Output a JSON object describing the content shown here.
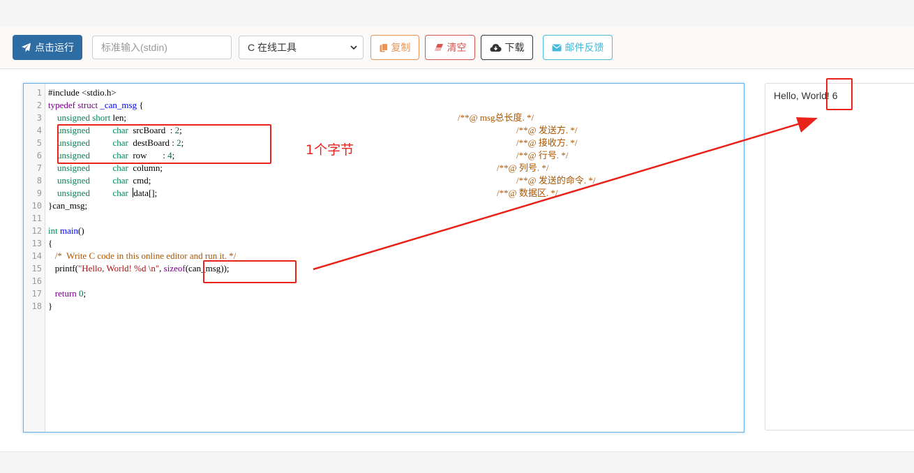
{
  "toolbar": {
    "run_label": "点击运行",
    "stdin_placeholder": "标准输入(stdin)",
    "language_selected": "C 在线工具",
    "copy_label": "复制",
    "clear_label": "清空",
    "download_label": "下载",
    "feedback_label": "邮件反馈"
  },
  "editor": {
    "line_numbers": [
      "1",
      "2",
      "3",
      "4",
      "5",
      "6",
      "7",
      "8",
      "9",
      "10",
      "11",
      "12",
      "13",
      "14",
      "15",
      "16",
      "17",
      "18"
    ],
    "lines": [
      [
        {
          "t": "#include <stdio.h>",
          "c": ""
        }
      ],
      [
        {
          "t": "typedef",
          "c": "kw"
        },
        {
          "t": " ",
          "c": ""
        },
        {
          "t": "struct",
          "c": "kw"
        },
        {
          "t": " ",
          "c": ""
        },
        {
          "t": "_can_msg",
          "c": "df"
        },
        {
          "t": " {",
          "c": ""
        }
      ],
      [
        {
          "t": "    ",
          "c": ""
        },
        {
          "t": "unsigned",
          "c": "ty"
        },
        {
          "t": " ",
          "c": ""
        },
        {
          "t": "short",
          "c": "ty"
        },
        {
          "t": " len;",
          "c": ""
        }
      ],
      [
        {
          "t": "    ",
          "c": ""
        },
        {
          "t": "unsigned",
          "c": "ty"
        },
        {
          "t": "          ",
          "c": ""
        },
        {
          "t": "char",
          "c": "ty"
        },
        {
          "t": "  srcBoard  : ",
          "c": ""
        },
        {
          "t": "2",
          "c": "nm"
        },
        {
          "t": ";",
          "c": ""
        }
      ],
      [
        {
          "t": "    ",
          "c": ""
        },
        {
          "t": "unsigned",
          "c": "ty"
        },
        {
          "t": "          ",
          "c": ""
        },
        {
          "t": "char",
          "c": "ty"
        },
        {
          "t": "  destBoard : ",
          "c": ""
        },
        {
          "t": "2",
          "c": "nm"
        },
        {
          "t": ";",
          "c": ""
        }
      ],
      [
        {
          "t": "    ",
          "c": ""
        },
        {
          "t": "unsigned",
          "c": "ty"
        },
        {
          "t": "          ",
          "c": ""
        },
        {
          "t": "char",
          "c": "ty"
        },
        {
          "t": "  row       : ",
          "c": ""
        },
        {
          "t": "4",
          "c": "nm"
        },
        {
          "t": ";",
          "c": ""
        }
      ],
      [
        {
          "t": "    ",
          "c": ""
        },
        {
          "t": "unsigned",
          "c": "ty"
        },
        {
          "t": "          ",
          "c": ""
        },
        {
          "t": "char",
          "c": "ty"
        },
        {
          "t": "  column;",
          "c": ""
        }
      ],
      [
        {
          "t": "    ",
          "c": ""
        },
        {
          "t": "unsigned",
          "c": "ty"
        },
        {
          "t": "          ",
          "c": ""
        },
        {
          "t": "char",
          "c": "ty"
        },
        {
          "t": "  cmd;",
          "c": ""
        }
      ],
      [
        {
          "t": "    ",
          "c": ""
        },
        {
          "t": "unsigned",
          "c": "ty"
        },
        {
          "t": "          ",
          "c": ""
        },
        {
          "t": "char",
          "c": "ty"
        },
        {
          "t": "  ",
          "c": ""
        },
        {
          "t": "|",
          "c": "cursor"
        },
        {
          "t": "data[];",
          "c": ""
        }
      ],
      [
        {
          "t": "}can_msg;",
          "c": ""
        }
      ],
      [],
      [
        {
          "t": "int",
          "c": "ty"
        },
        {
          "t": " ",
          "c": ""
        },
        {
          "t": "main",
          "c": "df"
        },
        {
          "t": "()",
          "c": ""
        }
      ],
      [
        {
          "t": "{",
          "c": ""
        }
      ],
      [
        {
          "t": "   ",
          "c": ""
        },
        {
          "t": "/*  Write C code in this online editor and run it. */",
          "c": "cm"
        }
      ],
      [
        {
          "t": "   printf(",
          "c": ""
        },
        {
          "t": "\"Hello, World! %d \\n\"",
          "c": "st"
        },
        {
          "t": ", ",
          "c": ""
        },
        {
          "t": "sizeof",
          "c": "kw"
        },
        {
          "t": "(can_msg));",
          "c": ""
        }
      ],
      [],
      [
        {
          "t": "   ",
          "c": ""
        },
        {
          "t": "return",
          "c": "kw"
        },
        {
          "t": " ",
          "c": ""
        },
        {
          "t": "0",
          "c": "nm"
        },
        {
          "t": ";",
          "c": ""
        }
      ],
      [
        {
          "t": "}",
          "c": ""
        }
      ]
    ],
    "comments": [
      "/**@ msg总长度. */",
      "/**@ 发送方. */",
      "/**@ 接收方. */",
      "/**@ 行号. */",
      "/**@ 列号. */",
      "/**@ 发送的命令. */",
      "/**@ 数据区. */"
    ]
  },
  "output": {
    "text": "Hello, World! 6"
  },
  "annotation": {
    "label": "1个字节",
    "color": "#e8231a"
  },
  "colors": {
    "run_button": "#2e6da4",
    "copy_button": "#e8955a",
    "clear_button": "#d9534f",
    "feedback_button": "#46b8da"
  }
}
